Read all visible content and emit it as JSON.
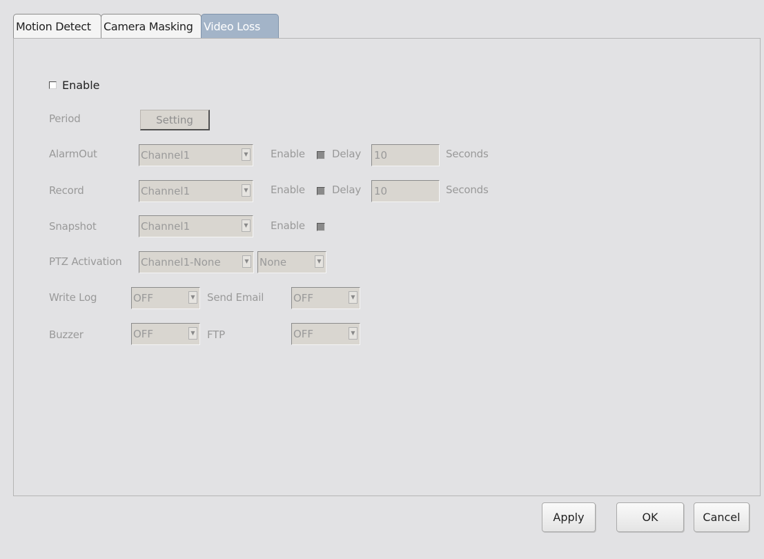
{
  "tabs": [
    {
      "label": "Motion Detect"
    },
    {
      "label": "Camera Masking"
    },
    {
      "label": "Video Loss"
    }
  ],
  "enable_label": "Enable",
  "period": {
    "label": "Period",
    "button": "Setting"
  },
  "alarm_out": {
    "label": "AlarmOut",
    "channel": "Channel1",
    "enable_label": "Enable",
    "delay_label": "Delay",
    "delay_value": "10",
    "unit": "Seconds"
  },
  "record": {
    "label": "Record",
    "channel": "Channel1",
    "enable_label": "Enable",
    "delay_label": "Delay",
    "delay_value": "10",
    "unit": "Seconds"
  },
  "snapshot": {
    "label": "Snapshot",
    "channel": "Channel1",
    "enable_label": "Enable"
  },
  "ptz": {
    "label": "PTZ Activation",
    "channel": "Channel1-None",
    "preset": "None"
  },
  "write_log": {
    "label": "Write Log",
    "value": "OFF"
  },
  "send_email": {
    "label": "Send Email",
    "value": "OFF"
  },
  "buzzer": {
    "label": "Buzzer",
    "value": "OFF"
  },
  "ftp": {
    "label": "FTP",
    "value": "OFF"
  },
  "buttons": {
    "apply": "Apply",
    "ok": "OK",
    "cancel": "Cancel"
  }
}
